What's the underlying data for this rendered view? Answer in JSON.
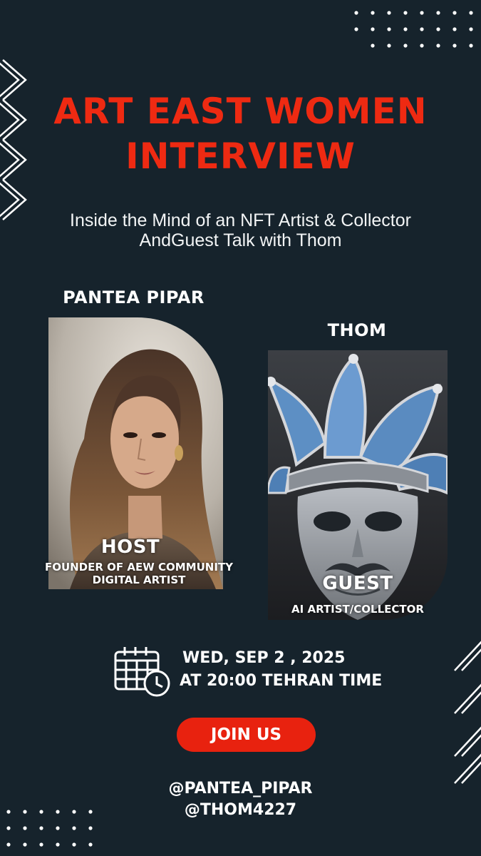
{
  "colors": {
    "background": "#16232c",
    "title": "#ee2a12",
    "button": "#e8220f",
    "text": "#ffffff"
  },
  "title": {
    "line1": "ART EAST WOMEN",
    "line2": "INTERVIEW"
  },
  "subtitle": {
    "line1": "Inside the Mind of an NFT Artist & Collector",
    "line2": "AndGuest Talk with Thom"
  },
  "host": {
    "name": "PANTEA PIPAR",
    "role": "HOST",
    "desc_line1": "FOUNDER OF AEW COMMUNITY",
    "desc_line2": "DIGITAL ARTIST",
    "photo": "woman-portrait"
  },
  "guest": {
    "name": "THOM",
    "role": "GUEST",
    "desc": "AI ARTIST/COLLECTOR",
    "photo": "jester-mask-artwork"
  },
  "event": {
    "date": "WED, SEP 2 , 2025",
    "time": "AT 20:00 TEHRAN TIME",
    "icon": "calendar-clock-icon"
  },
  "cta": {
    "label": "JOIN US"
  },
  "handles": [
    "@PANTEA_PIPAR",
    "@THOM4227"
  ]
}
